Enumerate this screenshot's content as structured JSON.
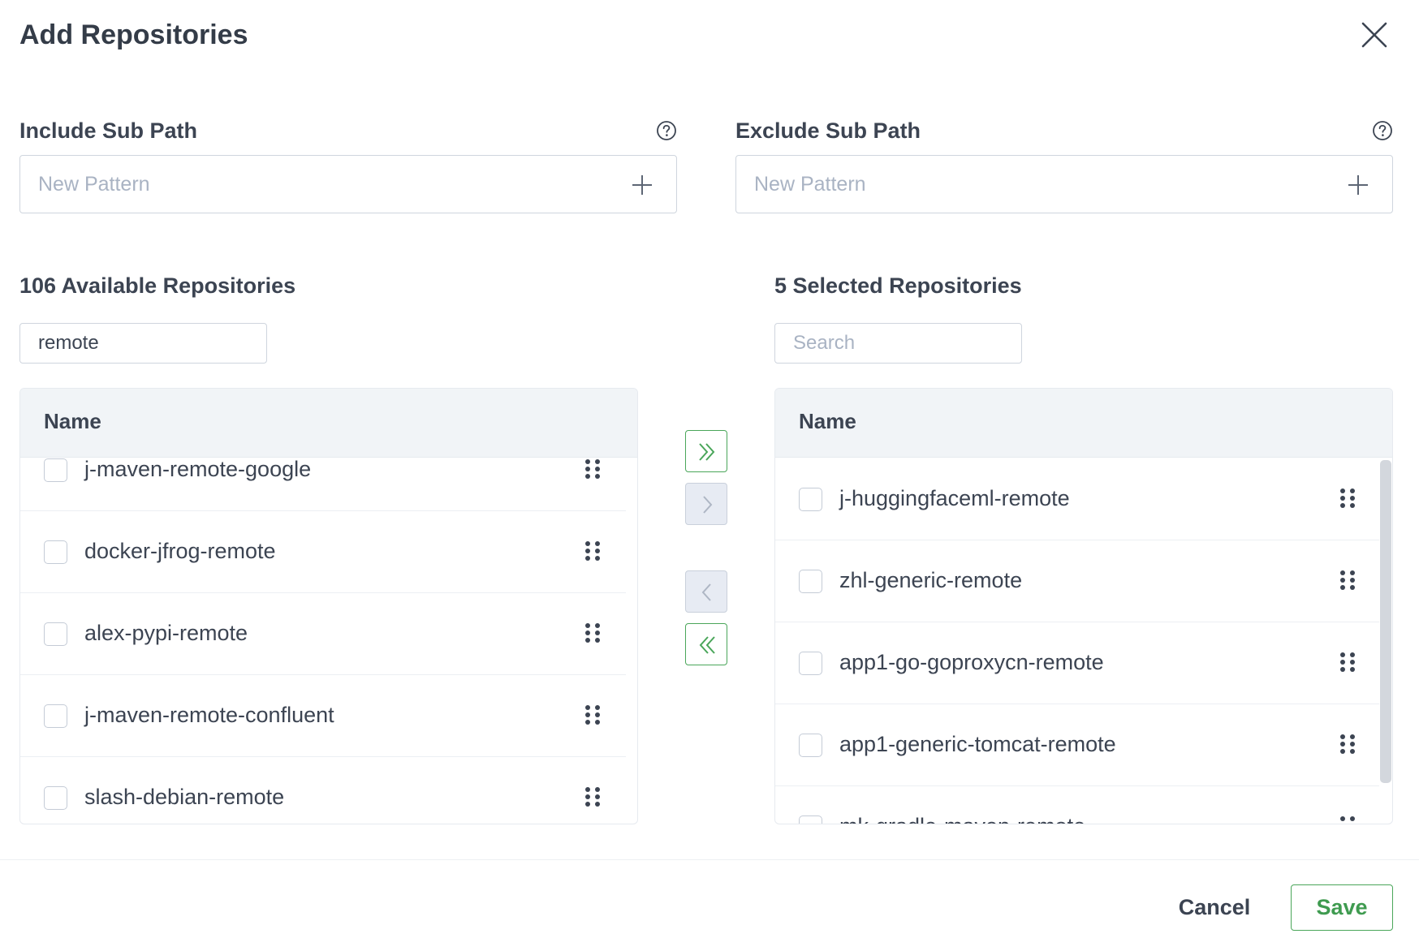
{
  "dialog": {
    "title": "Add Repositories",
    "close_icon": "close-icon"
  },
  "include_sub_path": {
    "label": "Include Sub Path",
    "placeholder": "New Pattern",
    "value": ""
  },
  "exclude_sub_path": {
    "label": "Exclude Sub Path",
    "placeholder": "New Pattern",
    "value": ""
  },
  "available": {
    "title": "106 Available Repositories",
    "search_value": "remote",
    "search_placeholder": "Search",
    "column_header": "Name",
    "items": [
      {
        "name": "j-maven-remote-google"
      },
      {
        "name": "docker-jfrog-remote"
      },
      {
        "name": "alex-pypi-remote"
      },
      {
        "name": "j-maven-remote-confluent"
      },
      {
        "name": "slash-debian-remote"
      }
    ]
  },
  "selected": {
    "title": "5 Selected Repositories",
    "search_value": "",
    "search_placeholder": "Search",
    "column_header": "Name",
    "items": [
      {
        "name": "j-huggingfaceml-remote"
      },
      {
        "name": "zhl-generic-remote"
      },
      {
        "name": "app1-go-goproxycn-remote"
      },
      {
        "name": "app1-generic-tomcat-remote"
      },
      {
        "name": "mk-gradle-maven-remote"
      }
    ]
  },
  "transfer_controls": {
    "move_all_right": "double-chevron-right-icon",
    "move_right": "chevron-right-icon",
    "move_left": "chevron-left-icon",
    "move_all_left": "double-chevron-left-icon"
  },
  "footer": {
    "cancel_label": "Cancel",
    "save_label": "Save"
  },
  "colors": {
    "accent": "#4aa65a",
    "header_bg": "#f1f4f7",
    "text": "#3c4452",
    "placeholder": "#a9b3c3"
  }
}
